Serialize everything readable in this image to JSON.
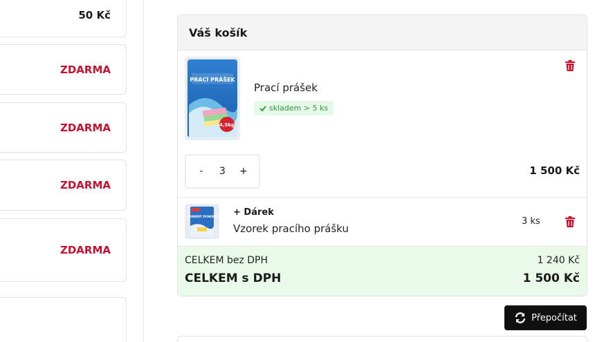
{
  "left_options": [
    {
      "price": "50 Kč",
      "style": "dark"
    },
    {
      "price": "ZDARMA",
      "style": "red"
    },
    {
      "price": "ZDARMA",
      "style": "red"
    },
    {
      "price": "ZDARMA",
      "style": "red"
    },
    {
      "price": "ZDARMA",
      "style": "red"
    }
  ],
  "cart": {
    "title": "Váš košík",
    "item": {
      "name": "Prací prášek",
      "stock": "skladem > 5 ks",
      "package_text": "PRACÍ PRÁŠEK",
      "package_weight": "4,5kg",
      "quantity": "3",
      "decrement": "-",
      "increment": "+",
      "price": "1 500 Kč"
    },
    "gift": {
      "label": "+ Dárek",
      "name": "Vzorek pracího prášku",
      "package_text": "LAUNDRY POWDER",
      "quantity": "3 ks"
    },
    "totals": {
      "without_vat_label": "CELKEM bez DPH",
      "without_vat_value": "1 240 Kč",
      "with_vat_label": "CELKEM s DPH",
      "with_vat_value": "1 500 Kč"
    }
  },
  "recalculate_label": "Přepočítat",
  "colors": {
    "accent_red": "#c8102e",
    "stock_green": "#2e9e3a",
    "totals_bg": "#eafaea",
    "button_bg": "#0f0f0f"
  }
}
